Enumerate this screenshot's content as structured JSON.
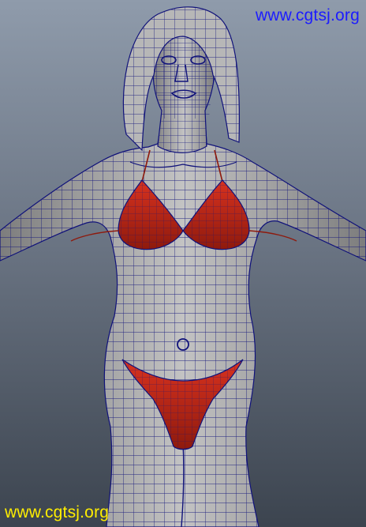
{
  "viewport": {
    "background_top": "#8f9bab",
    "background_bottom": "#3c444f"
  },
  "model": {
    "mesh_color": "#c3c3c3",
    "mesh_shadow": "#7d7d7d",
    "wire_color": "#10127a",
    "garment_color": "#d8321f",
    "garment_shadow": "#8e1a0d",
    "hair_color": "#b7b7b7"
  },
  "watermarks": {
    "top_text": "www.cgtsj.org",
    "top_color": "#1c1cff",
    "bottom_text": "www.cgtsj.org",
    "bottom_color": "#ffee00"
  }
}
